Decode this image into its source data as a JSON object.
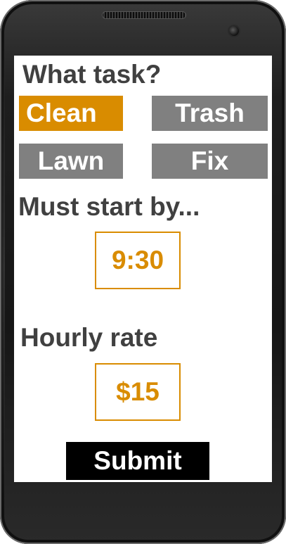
{
  "task_section": {
    "title": "What task?",
    "options": [
      {
        "label": "Clean",
        "selected": true
      },
      {
        "label": "Trash",
        "selected": false
      },
      {
        "label": "Lawn",
        "selected": false
      },
      {
        "label": "Fix",
        "selected": false
      }
    ]
  },
  "start_section": {
    "title": "Must start by...",
    "value": "9:30"
  },
  "rate_section": {
    "title": "Hourly rate",
    "value": "$15"
  },
  "submit": {
    "label": "Submit"
  },
  "colors": {
    "accent": "#d98c00",
    "inactive": "#808080",
    "text": "#404040",
    "submit_bg": "#000000"
  }
}
